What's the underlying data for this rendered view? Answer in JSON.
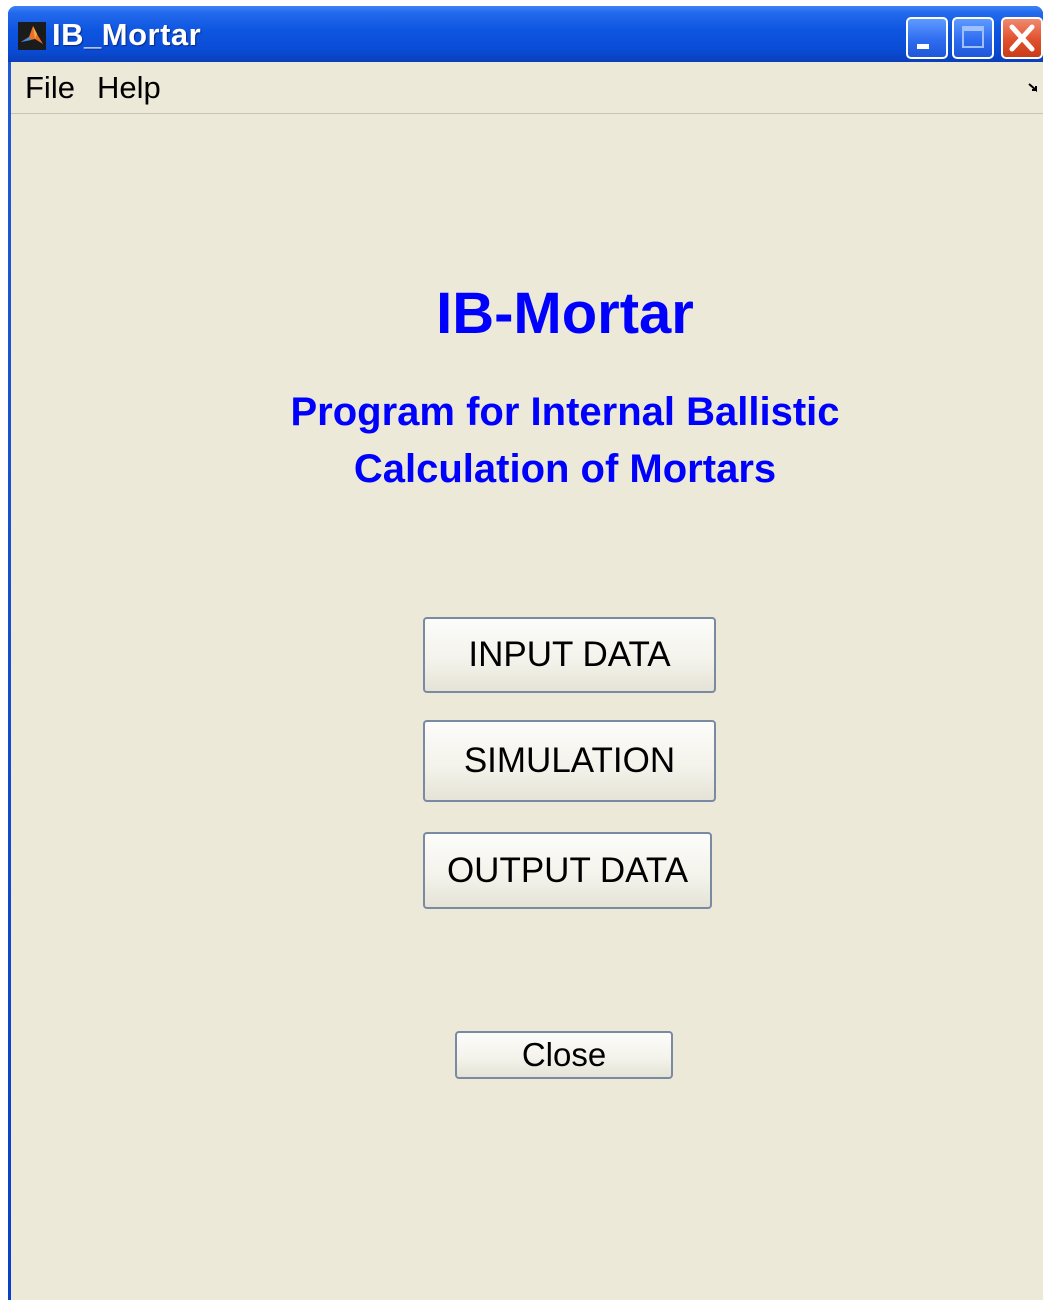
{
  "window": {
    "title": "IB_Mortar"
  },
  "menu": {
    "items": [
      "File",
      "Help"
    ]
  },
  "main": {
    "app_title": "IB-Mortar",
    "subtitle_line1": "Program for Internal Ballistic",
    "subtitle_line2": "Calculation of Mortars",
    "buttons": {
      "input": "INPUT DATA",
      "simulation": "SIMULATION",
      "output": "OUTPUT DATA",
      "close": "Close"
    }
  },
  "colors": {
    "titlebar": "#0a4bd5",
    "background": "#ece9d8",
    "heading_text": "#0000ff",
    "close_button": "#e0502d"
  },
  "icons": {
    "app": "matlab-logo-icon",
    "minimize": "minimize-icon",
    "maximize": "maximize-icon",
    "close": "close-icon",
    "menu_overflow": "menu-overflow-arrow-icon"
  }
}
